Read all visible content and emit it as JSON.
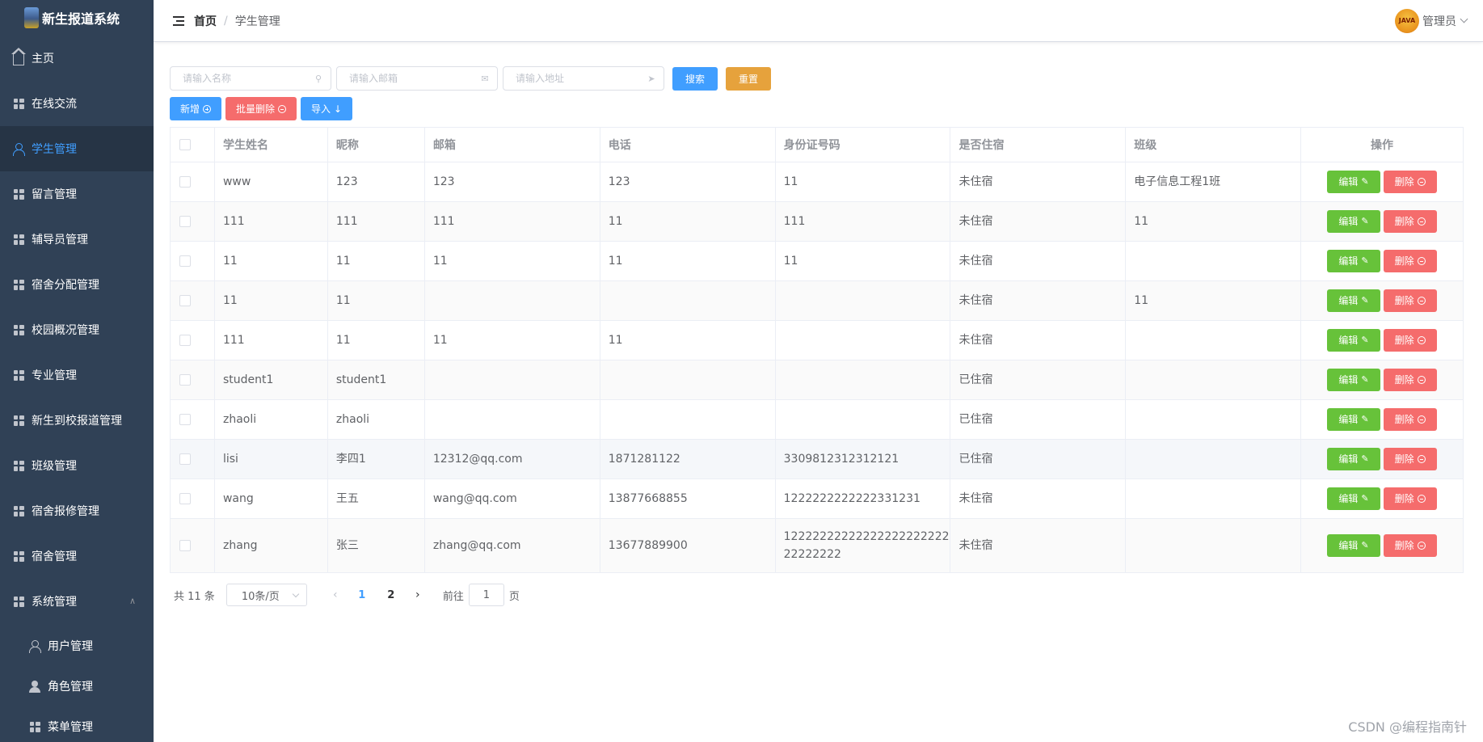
{
  "app": {
    "title": "新生报道系统"
  },
  "sidebar": {
    "items": [
      {
        "label": "主页",
        "icon": "home-icon"
      },
      {
        "label": "在线交流",
        "icon": "grid-icon"
      },
      {
        "label": "学生管理",
        "icon": "user-icon",
        "active": true
      },
      {
        "label": "留言管理",
        "icon": "grid-icon"
      },
      {
        "label": "辅导员管理",
        "icon": "grid-icon"
      },
      {
        "label": "宿舍分配管理",
        "icon": "grid-icon"
      },
      {
        "label": "校园概况管理",
        "icon": "grid-icon"
      },
      {
        "label": "专业管理",
        "icon": "grid-icon"
      },
      {
        "label": "新生到校报道管理",
        "icon": "grid-icon"
      },
      {
        "label": "班级管理",
        "icon": "grid-icon"
      },
      {
        "label": "宿舍报修管理",
        "icon": "grid-icon"
      },
      {
        "label": "宿舍管理",
        "icon": "grid-icon"
      },
      {
        "label": "系统管理",
        "icon": "menu-grid-icon",
        "expanded": true
      }
    ],
    "sub_items": [
      {
        "label": "用户管理",
        "icon": "user-icon"
      },
      {
        "label": "角色管理",
        "icon": "user-filled-icon"
      },
      {
        "label": "菜单管理",
        "icon": "grid-icon"
      }
    ]
  },
  "header": {
    "breadcrumb_home": "首页",
    "breadcrumb_separator": "/",
    "breadcrumb_current": "学生管理",
    "avatar_text": "JAVA",
    "username": "管理员"
  },
  "search": {
    "name_placeholder": "请输入名称",
    "email_placeholder": "请输入邮箱",
    "address_placeholder": "请输入地址",
    "search_label": "搜索",
    "reset_label": "重置"
  },
  "actions": {
    "add_label": "新增",
    "batch_delete_label": "批量删除",
    "import_label": "导入"
  },
  "table": {
    "columns": [
      "学生姓名",
      "昵称",
      "邮箱",
      "电话",
      "身份证号码",
      "是否住宿",
      "班级",
      "操作"
    ],
    "edit_label": "编辑",
    "delete_label": "删除",
    "rows": [
      [
        "www",
        "123",
        "123",
        "123",
        "11",
        "未住宿",
        "电子信息工程1班"
      ],
      [
        "111",
        "111",
        "111",
        "11",
        "111",
        "未住宿",
        "11"
      ],
      [
        "11",
        "11",
        "11",
        "11",
        "11",
        "未住宿",
        ""
      ],
      [
        "11",
        "11",
        "",
        "",
        "",
        "未住宿",
        "11"
      ],
      [
        "111",
        "11",
        "11",
        "11",
        "",
        "未住宿",
        ""
      ],
      [
        "student1",
        "student1",
        "",
        "",
        "",
        "已住宿",
        ""
      ],
      [
        "zhaoli",
        "zhaoli",
        "",
        "",
        "",
        "已住宿",
        ""
      ],
      [
        "lisi",
        "李四1",
        "12312@qq.com",
        "1871281122",
        "3309812312312121",
        "已住宿",
        ""
      ],
      [
        "wang",
        "王五",
        "wang@qq.com",
        "13877668855",
        "1222222222222331231",
        "未住宿",
        ""
      ],
      [
        "zhang",
        "张三",
        "zhang@qq.com",
        "13677889900",
        "1222222222222222222222222222222",
        "未住宿",
        ""
      ]
    ]
  },
  "pagination": {
    "total_text": "共 11 条",
    "page_size": "10条/页",
    "pages": [
      "1",
      "2"
    ],
    "current_page": "1",
    "goto_prefix": "前往",
    "goto_value": "1",
    "goto_suffix": "页"
  },
  "watermark": "CSDN @编程指南针",
  "colors": {
    "sidebar_bg": "#304156",
    "primary": "#409eff",
    "success": "#67c23a",
    "danger": "#f56c6c",
    "warning": "#e6a23c"
  }
}
